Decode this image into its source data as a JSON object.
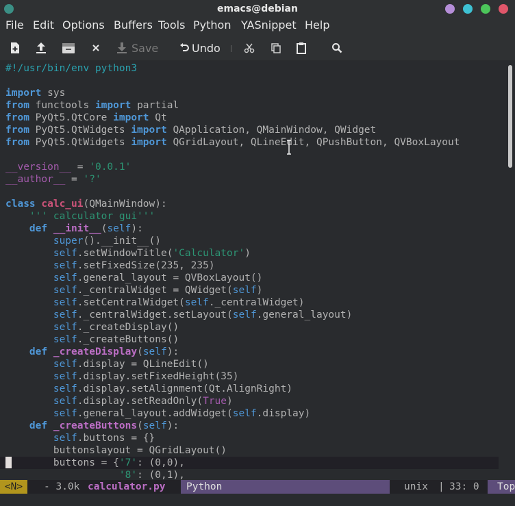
{
  "window": {
    "title": "emacs@debian"
  },
  "menu": [
    "File",
    "Edit",
    "Options",
    "Buffers",
    "Tools",
    "Python",
    "YASnippet",
    "Help"
  ],
  "toolbar": {
    "save_label": "Save",
    "undo_label": "Undo"
  },
  "code_lines": [
    [
      [
        "#!/usr/bin/env python3",
        "cmt"
      ]
    ],
    [],
    [
      [
        "import",
        "kw"
      ],
      [
        " sys",
        ""
      ]
    ],
    [
      [
        "from",
        "kw"
      ],
      [
        " functools ",
        ""
      ],
      [
        "import",
        "kw"
      ],
      [
        " partial",
        ""
      ]
    ],
    [
      [
        "from",
        "kw"
      ],
      [
        " PyQt5.QtCore ",
        ""
      ],
      [
        "import",
        "kw"
      ],
      [
        " Qt",
        ""
      ]
    ],
    [
      [
        "from",
        "kw"
      ],
      [
        " PyQt5.QtWidgets ",
        ""
      ],
      [
        "import",
        "kw"
      ],
      [
        " QApplication, QMainWindow, QWidget",
        ""
      ]
    ],
    [
      [
        "from",
        "kw"
      ],
      [
        " PyQt5.QtWidgets ",
        ""
      ],
      [
        "import",
        "kw"
      ],
      [
        " QGridLayout, QLineEdit, QPushButton, QVBoxLayout",
        ""
      ]
    ],
    [],
    [
      [
        "__version__",
        "cst"
      ],
      [
        " = ",
        ""
      ],
      [
        "'0.0.1'",
        "str"
      ]
    ],
    [
      [
        "__author__",
        "cst"
      ],
      [
        " = ",
        ""
      ],
      [
        "'?'",
        "str"
      ]
    ],
    [],
    [
      [
        "class",
        "kw"
      ],
      [
        " ",
        ""
      ],
      [
        "calc_ui",
        "typ"
      ],
      [
        "(QMainWindow):",
        ""
      ]
    ],
    [
      [
        "    ",
        ""
      ],
      [
        "''' calculator gui'''",
        "str"
      ]
    ],
    [
      [
        "    ",
        ""
      ],
      [
        "def",
        "kw"
      ],
      [
        " ",
        ""
      ],
      [
        "__init__",
        "fn"
      ],
      [
        "(",
        ""
      ],
      [
        "self",
        "self"
      ],
      [
        "):",
        ""
      ]
    ],
    [
      [
        "        ",
        ""
      ],
      [
        "super",
        "self"
      ],
      [
        "().__init__()",
        ""
      ]
    ],
    [
      [
        "        ",
        ""
      ],
      [
        "self",
        "self"
      ],
      [
        ".setWindowTitle(",
        ""
      ],
      [
        "'Calculator'",
        "str"
      ],
      [
        ")",
        ""
      ]
    ],
    [
      [
        "        ",
        ""
      ],
      [
        "self",
        "self"
      ],
      [
        ".setFixedSize(235, 235)",
        ""
      ]
    ],
    [
      [
        "        ",
        ""
      ],
      [
        "self",
        "self"
      ],
      [
        ".general_layout = QVBoxLayout()",
        ""
      ]
    ],
    [
      [
        "        ",
        ""
      ],
      [
        "self",
        "self"
      ],
      [
        "._centralWidget = QWidget(",
        ""
      ],
      [
        "self",
        "self"
      ],
      [
        ")",
        ""
      ]
    ],
    [
      [
        "        ",
        ""
      ],
      [
        "self",
        "self"
      ],
      [
        ".setCentralWidget(",
        ""
      ],
      [
        "self",
        "self"
      ],
      [
        "._centralWidget)",
        ""
      ]
    ],
    [
      [
        "        ",
        ""
      ],
      [
        "self",
        "self"
      ],
      [
        "._centralWidget.setLayout(",
        ""
      ],
      [
        "self",
        "self"
      ],
      [
        ".general_layout)",
        ""
      ]
    ],
    [
      [
        "        ",
        ""
      ],
      [
        "self",
        "self"
      ],
      [
        "._createDisplay()",
        ""
      ]
    ],
    [
      [
        "        ",
        ""
      ],
      [
        "self",
        "self"
      ],
      [
        "._createButtons()",
        ""
      ]
    ],
    [
      [
        "    ",
        ""
      ],
      [
        "def",
        "kw"
      ],
      [
        " ",
        ""
      ],
      [
        "_createDisplay",
        "fn"
      ],
      [
        "(",
        ""
      ],
      [
        "self",
        "self"
      ],
      [
        "):",
        ""
      ]
    ],
    [
      [
        "        ",
        ""
      ],
      [
        "self",
        "self"
      ],
      [
        ".display = QLineEdit()",
        ""
      ]
    ],
    [
      [
        "        ",
        ""
      ],
      [
        "self",
        "self"
      ],
      [
        ".display.setFixedHeight(35)",
        ""
      ]
    ],
    [
      [
        "        ",
        ""
      ],
      [
        "self",
        "self"
      ],
      [
        ".display.setAlignment(Qt.AlignRight)",
        ""
      ]
    ],
    [
      [
        "        ",
        ""
      ],
      [
        "self",
        "self"
      ],
      [
        ".display.setReadOnly(",
        ""
      ],
      [
        "True",
        "cst"
      ],
      [
        ")",
        ""
      ]
    ],
    [
      [
        "        ",
        ""
      ],
      [
        "self",
        "self"
      ],
      [
        ".general_layout.addWidget(",
        ""
      ],
      [
        "self",
        "self"
      ],
      [
        ".display)",
        ""
      ]
    ],
    [
      [
        "    ",
        ""
      ],
      [
        "def",
        "kw"
      ],
      [
        " ",
        ""
      ],
      [
        "_createButtons",
        "fn"
      ],
      [
        "(",
        ""
      ],
      [
        "self",
        "self"
      ],
      [
        "):",
        ""
      ]
    ],
    [
      [
        "        ",
        ""
      ],
      [
        "self",
        "self"
      ],
      [
        ".buttons = {}",
        ""
      ]
    ],
    [
      [
        "        buttonslayout = QGridLayout()",
        ""
      ]
    ],
    [
      [
        "        buttons = {",
        ""
      ],
      [
        "'7'",
        "str"
      ],
      [
        ": (0,0),",
        ""
      ]
    ],
    [
      [
        "                   ",
        ""
      ],
      [
        "'8'",
        "str"
      ],
      [
        ": (0,1),",
        ""
      ]
    ]
  ],
  "modeline": {
    "state": "<N>",
    "size": "- 3.0k",
    "buffer": "calculator.py",
    "mode": "Python",
    "encoding": "unix",
    "sep": "|",
    "position": "33: 0",
    "scroll": "Top"
  },
  "colors": {
    "background": "#292b2e",
    "keyword": "#4f97d7",
    "string": "#2d9574",
    "function": "#bc6ec5",
    "state": "#b1951d"
  }
}
